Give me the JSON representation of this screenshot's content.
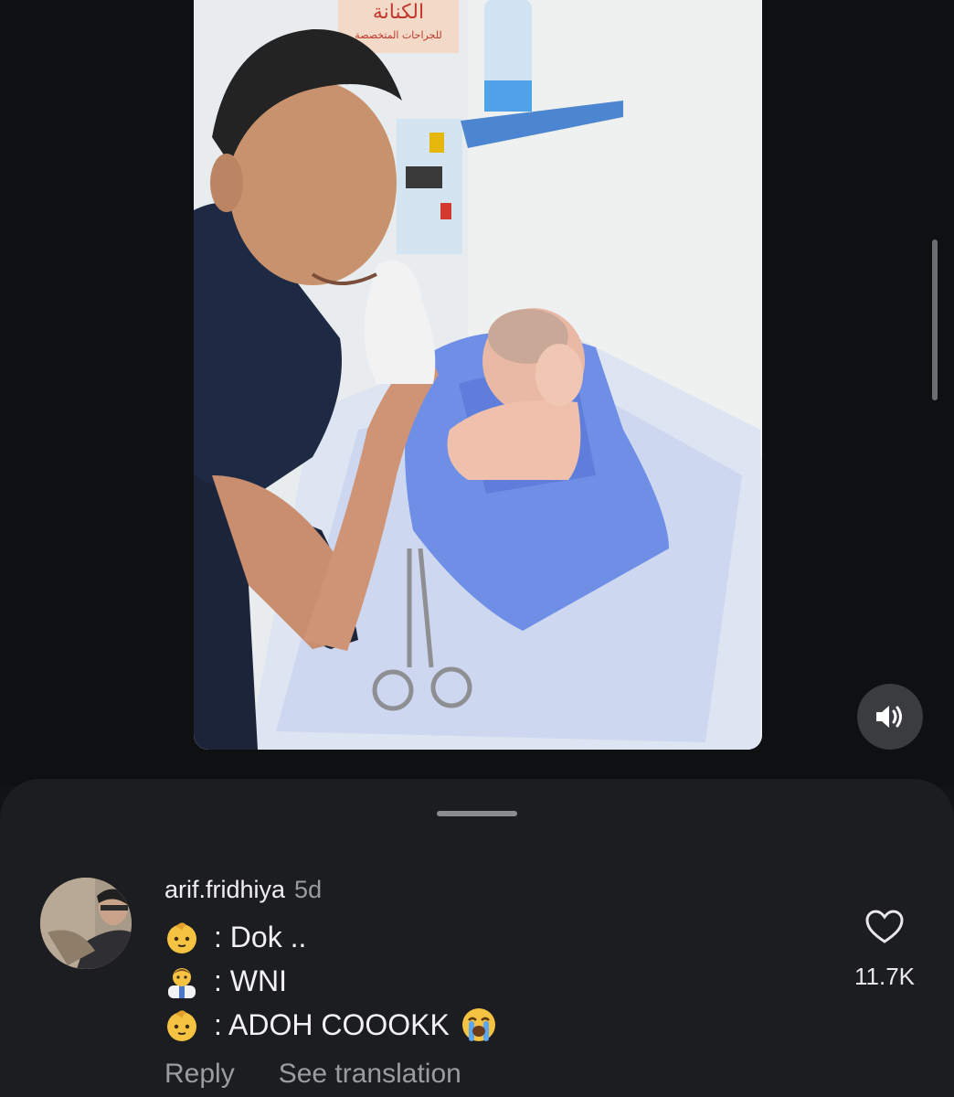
{
  "post": {
    "image_description": "",
    "photo_signage_text": "الكنانة",
    "photo_signage_subtext": "للجراحات المتخصصة"
  },
  "comment": {
    "username": "arif.fridhiya",
    "time_ago": "5d",
    "lines": [
      {
        "icon": "baby-emoji-icon",
        "text": ": Dok .."
      },
      {
        "icon": "doctor-emoji-icon",
        "text": ": WNI"
      },
      {
        "icon": "baby-emoji-icon",
        "text": ": ADOH COOOKK"
      }
    ],
    "reply_label": "Reply",
    "translate_label": "See translation",
    "like_count": "11.7K"
  },
  "colors": {
    "background": "#121316",
    "sheet": "#1c1d21",
    "secondary_text": "#9a9ca0",
    "drape_blue": "#6f8ee6"
  }
}
